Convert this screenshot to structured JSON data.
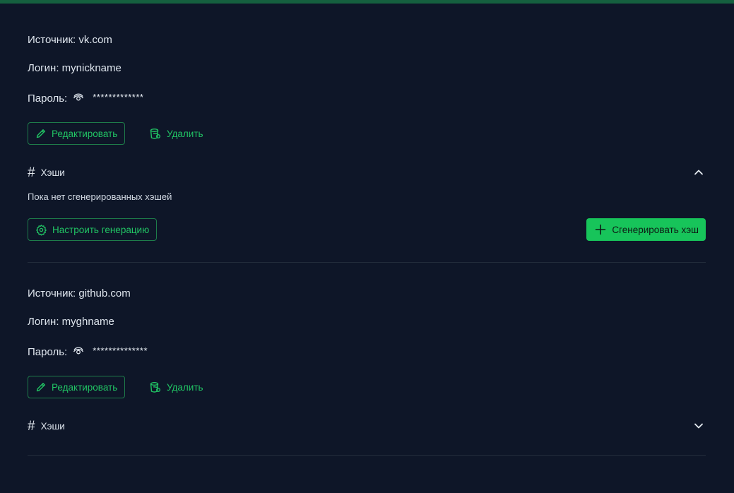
{
  "entries": [
    {
      "source_label": "Источник: vk.com",
      "login_label": "Логин: mynickname",
      "password_label": "Пароль:",
      "password_masked": "*************",
      "edit_label": "Редактировать",
      "delete_label": "Удалить",
      "hashes_label": "Хэши",
      "hashes_expanded": true,
      "hashes_empty_text": "Пока нет сгенерированных хэшей",
      "configure_label": "Настроить генерацию",
      "generate_label": "Сгенерировать хэш"
    },
    {
      "source_label": "Источник: github.com",
      "login_label": "Логин: myghname",
      "password_label": "Пароль:",
      "password_masked": "**************",
      "edit_label": "Редактировать",
      "delete_label": "Удалить",
      "hashes_label": "Хэши",
      "hashes_expanded": false
    }
  ],
  "colors": {
    "background": "#0e1628",
    "accent": "#21c464",
    "accent_solid": "#17c45a",
    "top_bar": "#15603f"
  },
  "icons": {
    "eye": "eye-icon",
    "edit": "pencil-icon",
    "delete": "trash-icon",
    "hash": "hash-icon",
    "chevron_up": "chevron-up-icon",
    "chevron_down": "chevron-down-icon",
    "configure": "gear-icon",
    "generate": "plus-icon"
  }
}
